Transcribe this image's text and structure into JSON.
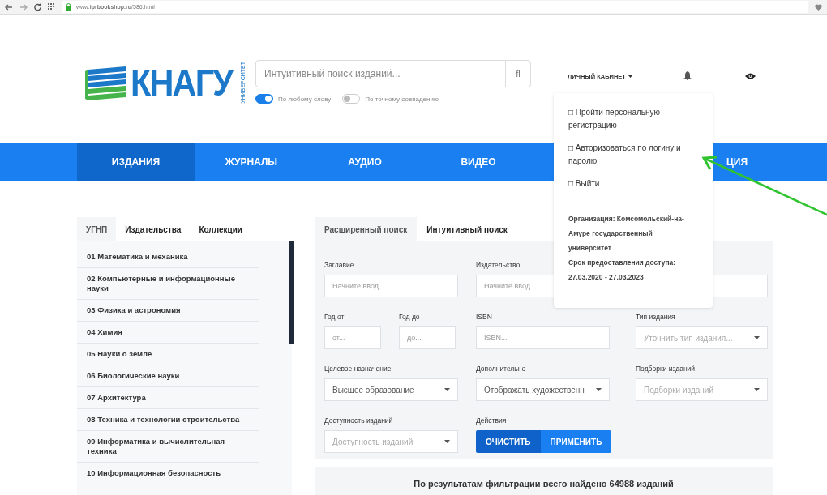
{
  "browser": {
    "url": "www.**iprbookshop.ru**/586.html"
  },
  "header": {
    "logo_text": "КНАГУ",
    "logo_subtext": "УНИВЕРСИТЕТ",
    "search_placeholder": "Интуитивный поиск изданий...",
    "search_button": "fl",
    "toggles": [
      {
        "label": "По любому слову",
        "on": true
      },
      {
        "label": "По точному совпадению",
        "on": false
      }
    ],
    "account": "ЛИЧНЫЙ КАБИНЕТ"
  },
  "nav": [
    {
      "label": "ИЗДАНИЯ",
      "selected": true
    },
    {
      "label": "ЖУРНАЛЫ",
      "selected": false
    },
    {
      "label": "АУДИО",
      "selected": false
    },
    {
      "label": "ВИДЕО",
      "selected": false
    },
    {
      "label": "ЦИЯ",
      "selected": false
    }
  ],
  "dropdown": {
    "items": [
      "□ Пройти персональную регистрацию",
      "□ Авторизоваться по логину и паролю",
      "□ Выйти"
    ],
    "organization": "Организация: Комсомольский-на-Амуре государственный университет",
    "access_label": "Срок предоставления доступа:",
    "access_dates": "27.03.2020 - 27.03.2023"
  },
  "sidebar": {
    "tabs": [
      {
        "label": "УГНП",
        "selected": true
      },
      {
        "label": "Издательства",
        "selected": false
      },
      {
        "label": "Коллекции",
        "selected": false
      }
    ],
    "items": [
      "01 Математика и механика",
      "02 Компьютерные и информационные науки",
      "03 Физика и астрономия",
      "04 Химия",
      "05 Науки о земле",
      "06 Биологические науки",
      "07 Архитектура",
      "08 Техника и технологии строительства",
      "09 Информатика и вычислительная техника",
      "10 Информационная безопасность"
    ]
  },
  "search_panel": {
    "tabs": [
      {
        "label": "Расширенный поиск",
        "selected": true
      },
      {
        "label": "Интуитивный поиск",
        "selected": false
      }
    ],
    "rows": [
      [
        {
          "kind": "input",
          "label": "Заглавие",
          "placeholder": "Начните ввод..."
        },
        {
          "kind": "input",
          "label": "Издательство",
          "placeholder": "Начните ввод..."
        },
        {
          "kind": "input"
        }
      ],
      [
        {
          "kind": "pair",
          "fields": [
            {
              "kind": "input",
              "label": "Год от",
              "placeholder": "от..."
            },
            {
              "kind": "input",
              "label": "Год до",
              "placeholder": "до..."
            }
          ]
        },
        {
          "kind": "input",
          "label": "ISBN",
          "placeholder": "ISBN..."
        },
        {
          "kind": "select",
          "label": "Тип издания",
          "placeholder": "Уточнить тип издания..."
        }
      ],
      [
        {
          "kind": "select",
          "label": "Целевое назначение",
          "value": "Высшее образование"
        },
        {
          "kind": "select",
          "label": "Дополнительно",
          "value": "Отображать художественн"
        },
        {
          "kind": "select",
          "label": "Подборки изданий",
          "placeholder": "Подборки изданий"
        }
      ],
      [
        {
          "kind": "select",
          "label": "Доступность изданий",
          "placeholder": "Доступность изданий"
        },
        {
          "kind": "actions",
          "label": "Действия",
          "buttons": [
            {
              "label": "ОЧИСТИТЬ",
              "kind": "clear"
            },
            {
              "label": "ПРИМЕНИТЬ",
              "kind": "apply"
            }
          ]
        }
      ]
    ]
  },
  "results": "По результатам фильтрации всего найдено 64988 изданий"
}
